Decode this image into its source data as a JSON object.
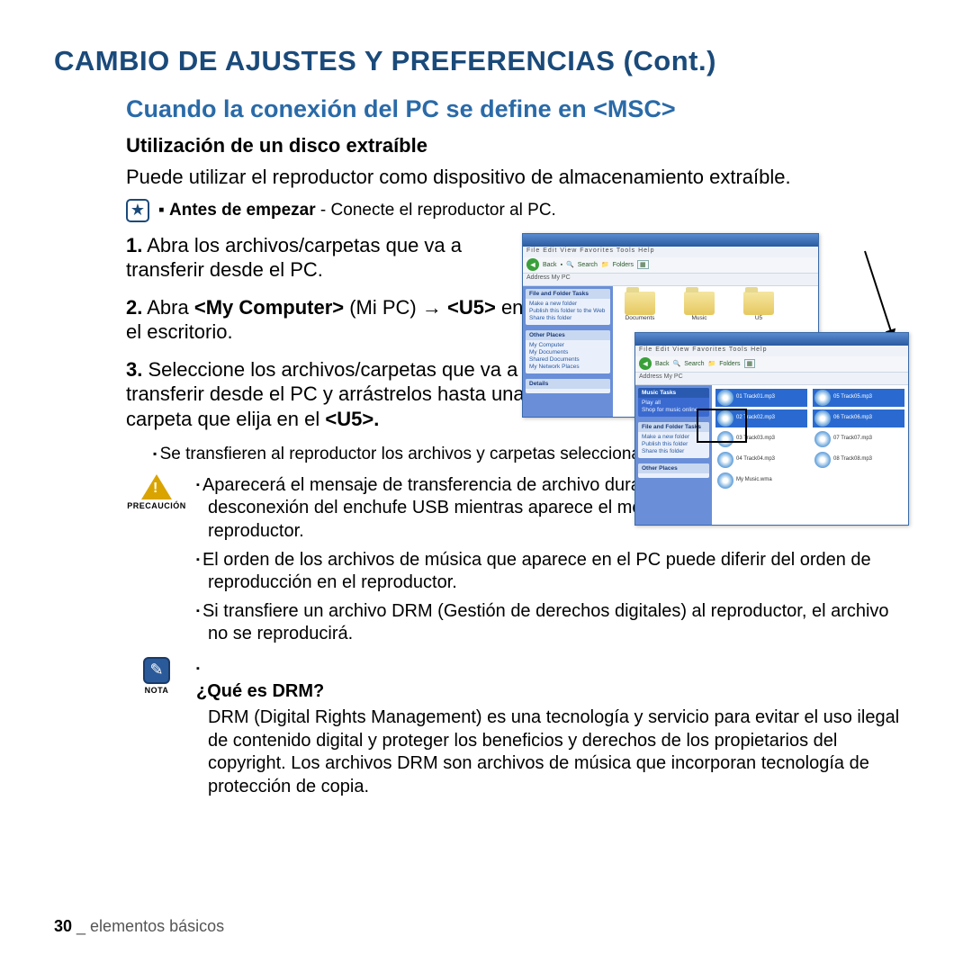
{
  "title": "CAMBIO DE AJUSTES Y PREFERENCIAS (Cont.)",
  "subtitle": "Cuando la conexión del PC se define en <MSC>",
  "section_head": "Utilización de un disco extraíble",
  "intro": "Puede utilizar el reproductor como dispositivo de almacenamiento extraíble.",
  "before_bold": "Antes de empezar",
  "before_rest": " - Conecte el reproductor al PC.",
  "steps": {
    "s1_num": "1.",
    "s1": " Abra los archivos/carpetas que va a transferir desde el PC.",
    "s2_num": "2.",
    "s2a": " Abra ",
    "s2b": "<My Computer>",
    "s2c": " (Mi PC) → ",
    "s2d": "<U5>",
    "s2e": " en el escritorio.",
    "s3_num": "3.",
    "s3a": " Seleccione los archivos/carpetas que va a transferir desde el PC y arrástrelos hasta una carpeta que elija en el ",
    "s3b": "<U5>."
  },
  "sub_bullet": "Se transfieren al reproductor los archivos y carpetas seleccionados.",
  "caution_label": "PRECAUCIÓN",
  "caution": {
    "b1": "Aparecerá el mensaje de transferencia de archivo durante la carga o descarga.La desconexión del enchufe USB mientras aparece el mensaje puede causar averías en el reproductor.",
    "b2": "El orden de los archivos de música que aparece en el PC puede diferir del orden de reproducción en el reproductor.",
    "b3": "Si transfiere un archivo DRM (Gestión de derechos digitales) al reproductor, el archivo no se reproducirá."
  },
  "note_label": "NOTA",
  "note": {
    "q": "¿Qué es DRM?",
    "body": "DRM (Digital Rights Management) es una tecnología y servicio para evitar el uso ilegal de contenido digital y proteger los beneficios y derechos de los propietarios del copyright. Los archivos DRM son archivos de música que incorporan tecnología de protección de copia."
  },
  "footer": {
    "num": "30",
    "sep": " _ ",
    "section": "elementos básicos"
  },
  "mock": {
    "menu": "File  Edit  View  Favorites  Tools  Help",
    "back": "Back",
    "search": "Search",
    "folders": "Folders",
    "addr": "Address  My PC",
    "panel1_head": "File and Folder Tasks",
    "panel1_items": [
      "Make a new folder",
      "Publish this folder to the Web",
      "Share this folder"
    ],
    "panel2_head": "Other Places",
    "panel2_items": [
      "My Computer",
      "My Documents",
      "Shared Documents",
      "My Network Places"
    ],
    "panel3_head": "Details",
    "folders_main": [
      "Documents",
      "Music",
      "U5"
    ],
    "win2_panel1": "Music Tasks",
    "win2_panel1_items": [
      "Play all",
      "Shop for music online"
    ],
    "win2_panel2": "File and Folder Tasks",
    "win2_panel2_items": [
      "Make a new folder",
      "Publish this folder",
      "Share this folder"
    ],
    "win2_panel3": "Other Places",
    "files": [
      "01 Track01.mp3",
      "05 Track05.mp3",
      "02 Track02.mp3",
      "06 Track06.mp3",
      "03 Track03.mp3",
      "07 Track07.mp3",
      "04 Track04.mp3",
      "08 Track08.mp3",
      "My Music.wma",
      ""
    ]
  }
}
